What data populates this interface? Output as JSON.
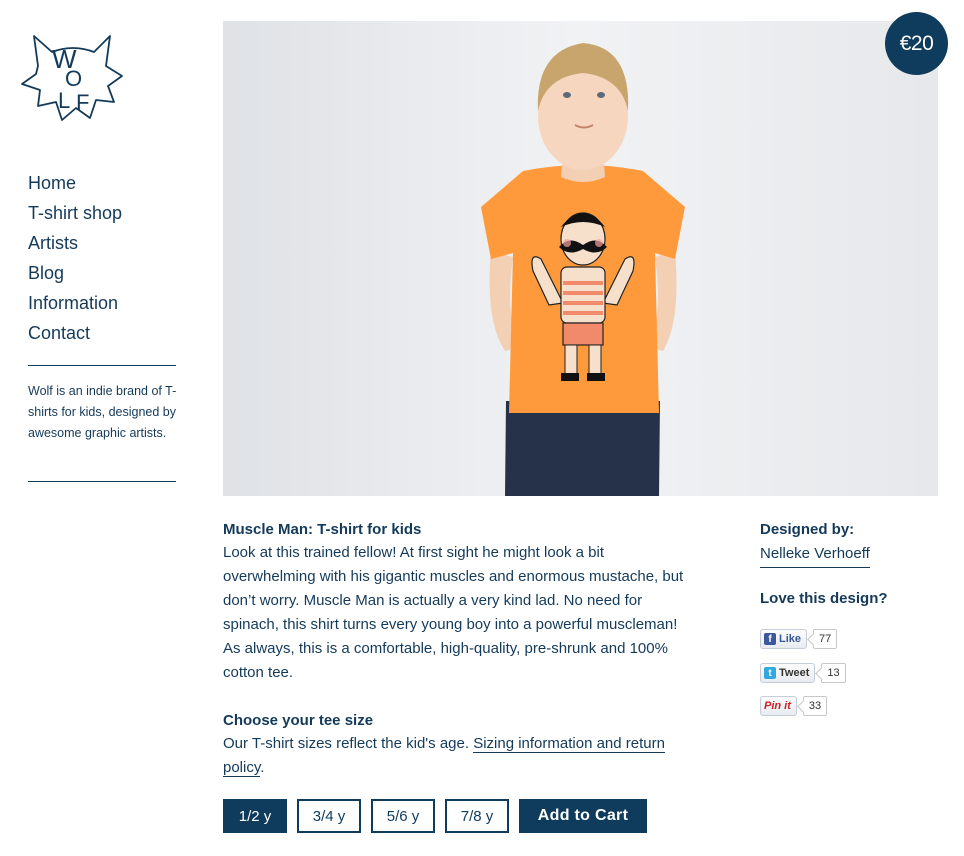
{
  "brand": {
    "logo_letters": [
      "W",
      "O",
      "L",
      "F"
    ]
  },
  "nav": {
    "items": [
      "Home",
      "T-shirt shop",
      "Artists",
      "Blog",
      "Information",
      "Contact"
    ]
  },
  "blurb": "Wolf is an indie brand of T-shirts for kids, designed by awesome graphic artists.",
  "product": {
    "price": "€20",
    "title": "Muscle Man: T-shirt for kids",
    "description": "Look at this trained fellow! At first sight he might look a bit overwhelming with his gigantic muscles and enormous mustache, but don’t worry. Muscle Man is actually a very kind lad. No need for spinach, this shirt turns every young boy into a powerful muscleman! As always, this is a comfortable, high-quality, pre-shrunk and 100% cotton tee.",
    "size_title": "Choose your tee size",
    "size_text": "Our T-shirt sizes reflect the kid's age.",
    "size_link": "Sizing information and return policy",
    "size_link_suffix": ".",
    "sizes": [
      "1/2 y",
      "3/4 y",
      "5/6 y",
      "7/8 y"
    ],
    "selected_size": "1/2 y",
    "add_to_cart": "Add to Cart"
  },
  "sidebar": {
    "designed_by_label": "Designed by:",
    "designer": "Nelleke Verhoeff",
    "love_label": "Love this design?",
    "social": [
      {
        "icon": "facebook-icon",
        "label": "Like",
        "count": "77",
        "color": "#3b5998"
      },
      {
        "icon": "twitter-icon",
        "label": "Tweet",
        "count": "13",
        "color": "#2fa9e0"
      },
      {
        "icon": "pinterest-icon",
        "label": "Pin it",
        "count": "33",
        "color": "#cb2027"
      }
    ]
  },
  "colors": {
    "brand": "#0f3c5c",
    "text": "#143a5a",
    "shirt": "#ff9a3c"
  }
}
